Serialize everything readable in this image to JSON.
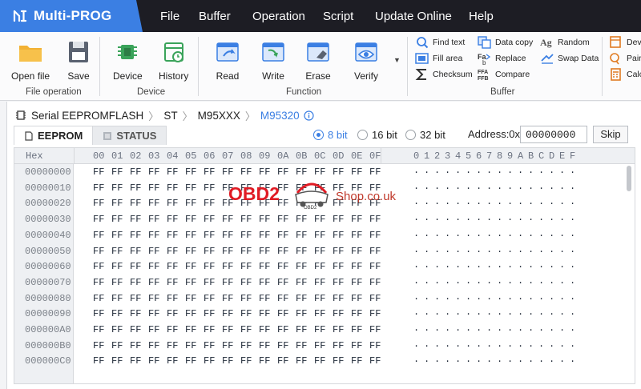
{
  "app": {
    "title": "Multi-PROG"
  },
  "menu": [
    "File",
    "Buffer",
    "Operation",
    "Script",
    "Update Online",
    "Help"
  ],
  "ribbon": {
    "file_group": {
      "label": "File operation",
      "open": "Open file",
      "save": "Save"
    },
    "device_group": {
      "label": "Device",
      "device": "Device",
      "history": "History"
    },
    "function_group": {
      "label": "Function",
      "read": "Read",
      "write": "Write",
      "erase": "Erase",
      "verify": "Verify"
    },
    "buffer_group": {
      "label": "Buffer",
      "find_text": "Find text",
      "fill_area": "Fill area",
      "checksum": "Checksum",
      "data_copy": "Data copy",
      "replace": "Replace",
      "compare": "Compare",
      "random": "Random",
      "swap_data": "Swap Data"
    },
    "extra_group": {
      "dev": "Dev",
      "pair": "Pair",
      "calc": "Calc"
    }
  },
  "breadcrumb": {
    "root": "Serial EEPROMFLASH",
    "brand": "ST",
    "family": "M95XXX",
    "chip": "M95320"
  },
  "tabs": {
    "eeprom": "EEPROM",
    "status": "STATUS"
  },
  "bit_options": {
    "selected": "8 bit",
    "opt8": "8 bit",
    "opt16": "16 bit",
    "opt32": "32 bit"
  },
  "address": {
    "label": "Address:0x",
    "value": "00000000",
    "skip": "Skip"
  },
  "hex": {
    "hex_label": "Hex",
    "columns": [
      "00",
      "01",
      "02",
      "03",
      "04",
      "05",
      "06",
      "07",
      "08",
      "09",
      "0A",
      "0B",
      "0C",
      "0D",
      "0E",
      "0F"
    ],
    "ascii_columns": [
      "0",
      "1",
      "2",
      "3",
      "4",
      "5",
      "6",
      "7",
      "8",
      "9",
      "A",
      "B",
      "C",
      "D",
      "E",
      "F"
    ],
    "rows": [
      "00000000",
      "00000010",
      "00000020",
      "00000030",
      "00000040",
      "00000050",
      "00000060",
      "00000070",
      "00000080",
      "00000090",
      "000000A0",
      "000000B0",
      "000000C0"
    ],
    "byte": "FF",
    "ascii_char": "."
  },
  "watermark": {
    "brand": "OBD2",
    "suffix": "Shop.co.uk",
    "car_text": "OBD2"
  }
}
